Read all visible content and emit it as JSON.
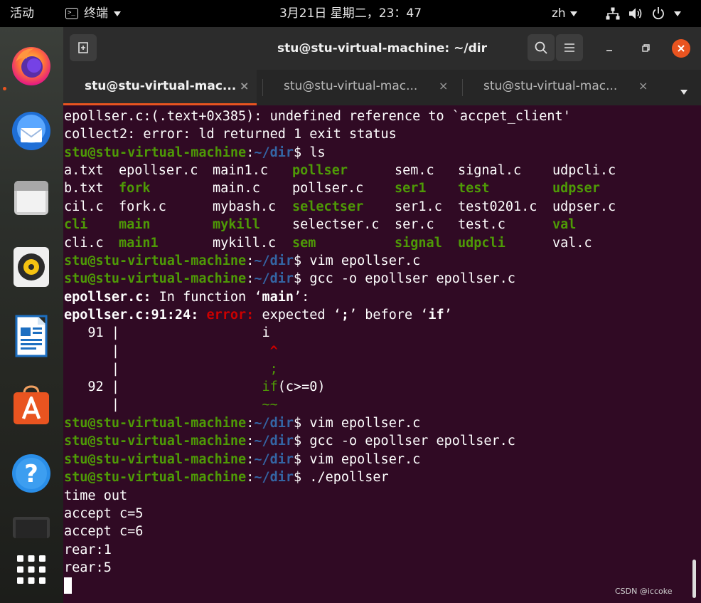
{
  "topbar": {
    "activities": "活动",
    "app_name": "终端",
    "clock": "3月21日 星期二，23：47",
    "language": "zh"
  },
  "dock": {
    "items": [
      "firefox-icon",
      "thunderbird-icon",
      "files-icon",
      "rhythmbox-icon",
      "libreoffice-writer-icon",
      "software-icon",
      "help-icon",
      "trash-icon",
      "show-apps-icon"
    ]
  },
  "window": {
    "title": "stu@stu-virtual-machine: ~/dir",
    "tabs": [
      {
        "label": "stu@stu-virtual-mac...",
        "close": "×",
        "active": true
      },
      {
        "label": "stu@stu-virtual-mac...",
        "close": "×",
        "active": false
      },
      {
        "label": "stu@stu-virtual-mac...",
        "close": "×",
        "active": false
      }
    ]
  },
  "prompt": {
    "user_host": "stu@stu-virtual-machine",
    "colon": ":",
    "path": "~/dir",
    "dollar": "$ "
  },
  "terminal": {
    "line0": "epollser.c:(.text+0x385): undefined reference to `accpet_client'",
    "line1": "collect2: error: ld returned 1 exit status",
    "cmd_ls": "ls",
    "ls_rows": [
      [
        {
          "name": "a.txt",
          "exe": false
        },
        {
          "name": "epollser.c",
          "exe": false
        },
        {
          "name": "main1.c",
          "exe": false
        },
        {
          "name": "pollser",
          "exe": true
        },
        {
          "name": "sem.c",
          "exe": false
        },
        {
          "name": "signal.c",
          "exe": false
        },
        {
          "name": "udpcli.c",
          "exe": false
        }
      ],
      [
        {
          "name": "b.txt",
          "exe": false
        },
        {
          "name": "fork",
          "exe": true
        },
        {
          "name": "main.c",
          "exe": false
        },
        {
          "name": "pollser.c",
          "exe": false
        },
        {
          "name": "ser1",
          "exe": true
        },
        {
          "name": "test",
          "exe": true
        },
        {
          "name": "udpser",
          "exe": true
        }
      ],
      [
        {
          "name": "cil.c",
          "exe": false
        },
        {
          "name": "fork.c",
          "exe": false
        },
        {
          "name": "mybash.c",
          "exe": false
        },
        {
          "name": "selectser",
          "exe": true
        },
        {
          "name": "ser1.c",
          "exe": false
        },
        {
          "name": "test0201.c",
          "exe": false
        },
        {
          "name": "udpser.c",
          "exe": false
        }
      ],
      [
        {
          "name": "cli",
          "exe": true
        },
        {
          "name": "main",
          "exe": true
        },
        {
          "name": "mykill",
          "exe": true
        },
        {
          "name": "selectser.c",
          "exe": false
        },
        {
          "name": "ser.c",
          "exe": false
        },
        {
          "name": "test.c",
          "exe": false
        },
        {
          "name": "val",
          "exe": true
        }
      ],
      [
        {
          "name": "cli.c",
          "exe": false
        },
        {
          "name": "main1",
          "exe": true
        },
        {
          "name": "mykill.c",
          "exe": false
        },
        {
          "name": "sem",
          "exe": true
        },
        {
          "name": "signal",
          "exe": true
        },
        {
          "name": "udpcli",
          "exe": true
        },
        {
          "name": "val.c",
          "exe": false
        }
      ]
    ],
    "cmd_vim1": "vim epollser.c",
    "cmd_gcc1": "gcc -o epollser epollser.c",
    "err_file1": "epollser.c:",
    "err_func_text": " In function ‘",
    "err_func_name": "main",
    "err_func_end": "’:",
    "err_loc": "epollser.c:91:24:",
    "err_word": " error:",
    "err_msg_pre": " expected ‘",
    "err_msg_tok1": ";",
    "err_msg_mid": "’ before ‘",
    "err_msg_tok2": "if",
    "err_msg_end": "’",
    "src_91_num": "   91 |",
    "src_91_code": "                  i",
    "src_gutter": "      |",
    "caret": "                   ^",
    "fixit_semicolon": "                   ;",
    "src_92_num": "   92 |",
    "src_92_kw": "                  if",
    "src_92_rest": "(c>=0)",
    "tilde": "                  ~~",
    "cmd_vim2": "vim epollser.c",
    "cmd_gcc2": "gcc -o epollser epollser.c",
    "cmd_vim3": "vim epollser.c",
    "cmd_run": "./epollser",
    "out1": "time out",
    "out2": "accept c=5",
    "out3": "accept c=6",
    "out4": "rear:1",
    "out5": "rear:5"
  },
  "watermark": "CSDN @iccoke",
  "colors": {
    "terminal_bg": "#300a24",
    "prompt_green": "#4e9a06",
    "path_blue": "#3465a4",
    "error_red": "#cc0000",
    "accent_orange": "#e95420"
  }
}
